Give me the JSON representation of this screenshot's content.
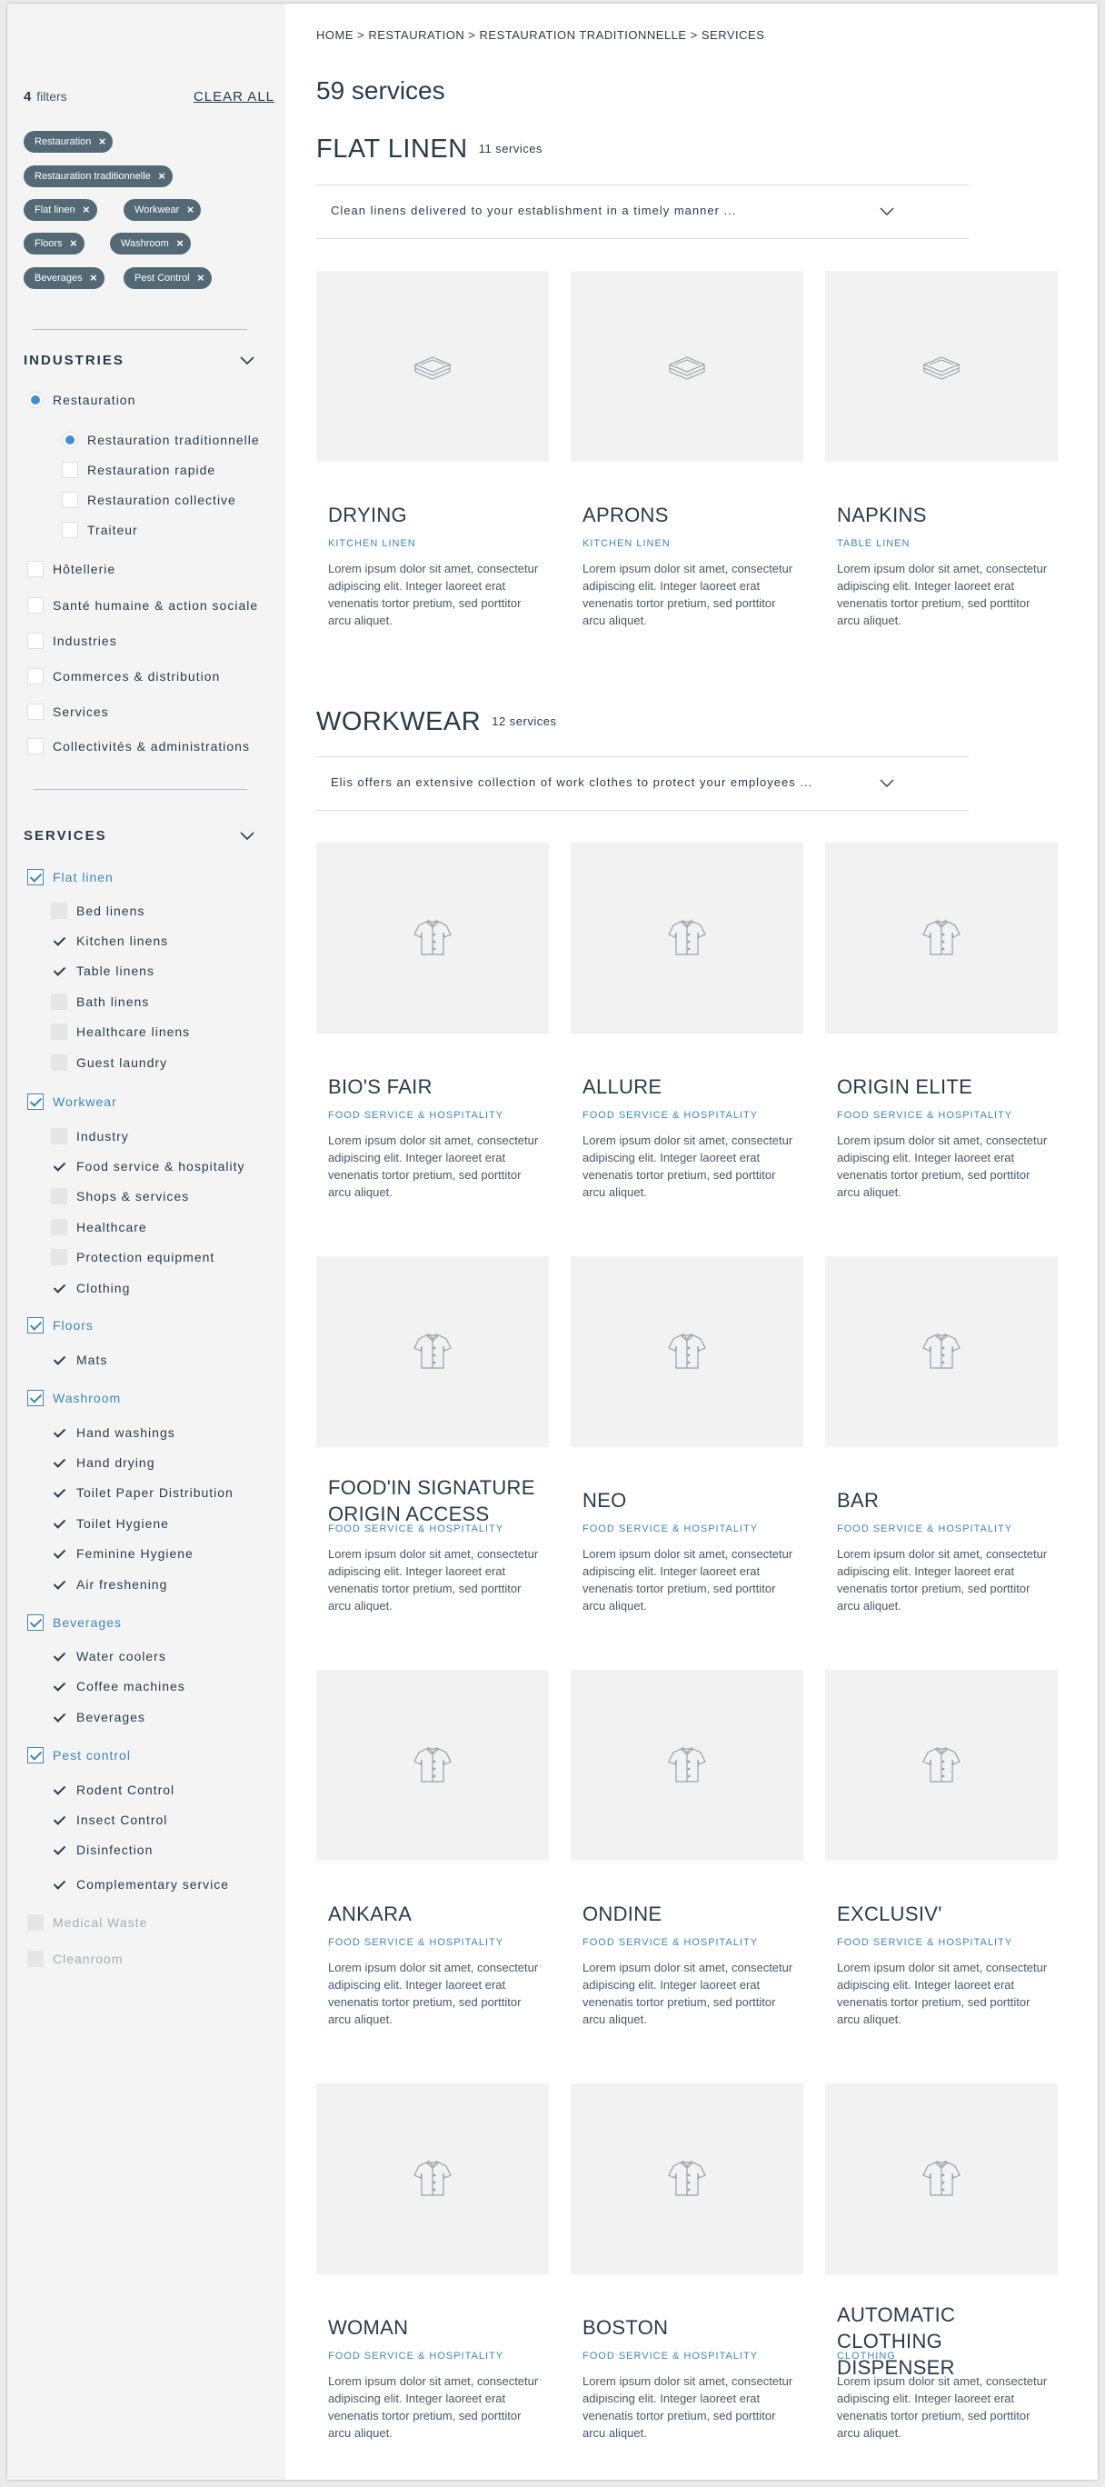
{
  "breadcrumb": "HOME > RESTAURATION > RESTAURATION TRADITIONNELLE > SERVICES",
  "results_title": "59 services",
  "filters": {
    "count": "4",
    "label": "filters",
    "clear_all": "CLEAR ALL",
    "chips": [
      "Restauration",
      "Restauration traditionnelle",
      "Flat linen",
      "Workwear",
      "Floors",
      "Washroom",
      "Beverages",
      "Pest Control"
    ]
  },
  "industries": {
    "title": "INDUSTRIES",
    "restauration": "Restauration",
    "restauration_subs": [
      "Restauration traditionnelle",
      "Restauration rapide",
      "Restauration collective",
      "Traiteur"
    ],
    "others": [
      "Hôtellerie",
      "Santé humaine & action sociale",
      "Industries",
      "Commerces & distribution",
      "Services",
      "Collectivités & administrations"
    ]
  },
  "services": {
    "title": "SERVICES",
    "groups": [
      {
        "label": "Flat linen",
        "items": [
          "Bed linens",
          "Kitchen linens",
          "Table linens",
          "Bath linens",
          "Healthcare linens",
          "Guest laundry"
        ]
      },
      {
        "label": "Workwear",
        "items": [
          "Industry",
          "Food service & hospitality",
          "Shops & services",
          "Healthcare",
          "Protection equipment",
          "Clothing"
        ]
      },
      {
        "label": "Floors",
        "items": [
          "Mats"
        ]
      },
      {
        "label": "Washroom",
        "items": [
          "Hand washings",
          "Hand drying",
          "Toilet Paper Distribution",
          "Toilet Hygiene",
          "Feminine Hygiene",
          "Air freshening"
        ]
      },
      {
        "label": "Beverages",
        "items": [
          "Water coolers",
          "Coffee machines",
          "Beverages"
        ]
      },
      {
        "label": "Pest control",
        "items": [
          "Rodent Control",
          "Insect Control",
          "Disinfection",
          "Complementary service"
        ]
      }
    ],
    "disabled": [
      "Medical Waste",
      "Cleanroom"
    ]
  },
  "categories": [
    {
      "title": "FLAT LINEN",
      "count": "11 services",
      "intro": "Clean linens delivered to your establishment in a timely manner ...",
      "icon": "folded-linen-icon",
      "cards": [
        {
          "name": "DRYING",
          "tag": "KITCHEN LINEN",
          "desc": "Lorem ipsum dolor sit amet, consectetur adipiscing elit. Integer laoreet erat venenatis tortor pretium, sed porttitor arcu aliquet."
        },
        {
          "name": "APRONS",
          "tag": "KITCHEN LINEN",
          "desc": "Lorem ipsum dolor sit amet, consectetur adipiscing elit. Integer laoreet erat venenatis tortor pretium, sed porttitor arcu aliquet."
        },
        {
          "name": "NAPKINS",
          "tag": "TABLE LINEN",
          "desc": "Lorem ipsum dolor sit amet, consectetur adipiscing elit. Integer laoreet erat venenatis tortor pretium, sed porttitor arcu aliquet."
        }
      ]
    },
    {
      "title": "WORKWEAR",
      "count": "12 services",
      "intro": "Elis offers an extensive collection of work clothes to protect your employees ...",
      "icon": "shirt-icon",
      "cards": [
        {
          "name": "BIO'S FAIR",
          "tag": "FOOD SERVICE & HOSPITALITY",
          "desc": "Lorem ipsum dolor sit amet, consectetur adipiscing elit. Integer laoreet erat venenatis tortor pretium, sed porttitor arcu aliquet."
        },
        {
          "name": "ALLURE",
          "tag": "FOOD SERVICE & HOSPITALITY",
          "desc": "Lorem ipsum dolor sit amet, consectetur adipiscing elit. Integer laoreet erat venenatis tortor pretium, sed porttitor arcu aliquet."
        },
        {
          "name": "ORIGIN ELITE",
          "tag": "FOOD SERVICE & HOSPITALITY",
          "desc": "Lorem ipsum dolor sit amet, consectetur adipiscing elit. Integer laoreet erat venenatis tortor pretium, sed porttitor arcu aliquet."
        },
        {
          "name": "FOOD'IN SIGNATURE ORIGIN ACCESS",
          "tag": "FOOD SERVICE & HOSPITALITY",
          "desc": "Lorem ipsum dolor sit amet, consectetur adipiscing elit. Integer laoreet erat venenatis tortor pretium, sed porttitor arcu aliquet."
        },
        {
          "name": "NEO",
          "tag": "FOOD SERVICE & HOSPITALITY",
          "desc": "Lorem ipsum dolor sit amet, consectetur adipiscing elit. Integer laoreet erat venenatis tortor pretium, sed porttitor arcu aliquet."
        },
        {
          "name": "BAR",
          "tag": "FOOD SERVICE & HOSPITALITY",
          "desc": "Lorem ipsum dolor sit amet, consectetur adipiscing elit. Integer laoreet erat venenatis tortor pretium, sed porttitor arcu aliquet."
        },
        {
          "name": "ANKARA",
          "tag": "FOOD SERVICE & HOSPITALITY",
          "desc": "Lorem ipsum dolor sit amet, consectetur adipiscing elit. Integer laoreet erat venenatis tortor pretium, sed porttitor arcu aliquet."
        },
        {
          "name": "ONDINE",
          "tag": "FOOD SERVICE & HOSPITALITY",
          "desc": "Lorem ipsum dolor sit amet, consectetur adipiscing elit. Integer laoreet erat venenatis tortor pretium, sed porttitor arcu aliquet."
        },
        {
          "name": "EXCLUSIV'",
          "tag": "FOOD SERVICE & HOSPITALITY",
          "desc": "Lorem ipsum dolor sit amet, consectetur adipiscing elit. Integer laoreet erat venenatis tortor pretium, sed porttitor arcu aliquet."
        },
        {
          "name": "WOMAN",
          "tag": "FOOD SERVICE & HOSPITALITY",
          "desc": "Lorem ipsum dolor sit amet, consectetur adipiscing elit. Integer laoreet erat venenatis tortor pretium, sed porttitor arcu aliquet."
        },
        {
          "name": "BOSTON",
          "tag": "FOOD SERVICE & HOSPITALITY",
          "desc": "Lorem ipsum dolor sit amet, consectetur adipiscing elit. Integer laoreet erat venenatis tortor pretium, sed porttitor arcu aliquet."
        },
        {
          "name": "AUTOMATIC CLOTHING DISPENSER",
          "tag": "CLOTHING",
          "desc": "Lorem ipsum dolor sit amet, consectetur adipiscing elit. Integer laoreet erat venenatis tortor pretium, sed porttitor arcu aliquet."
        }
      ]
    }
  ],
  "colors": {
    "chip_bg": "#546976",
    "accent_blue": "#3d86b8",
    "radio_blue": "#3f8fd2",
    "text_dark": "#2b3a4a",
    "thumb_bg": "#f2f2f2"
  }
}
